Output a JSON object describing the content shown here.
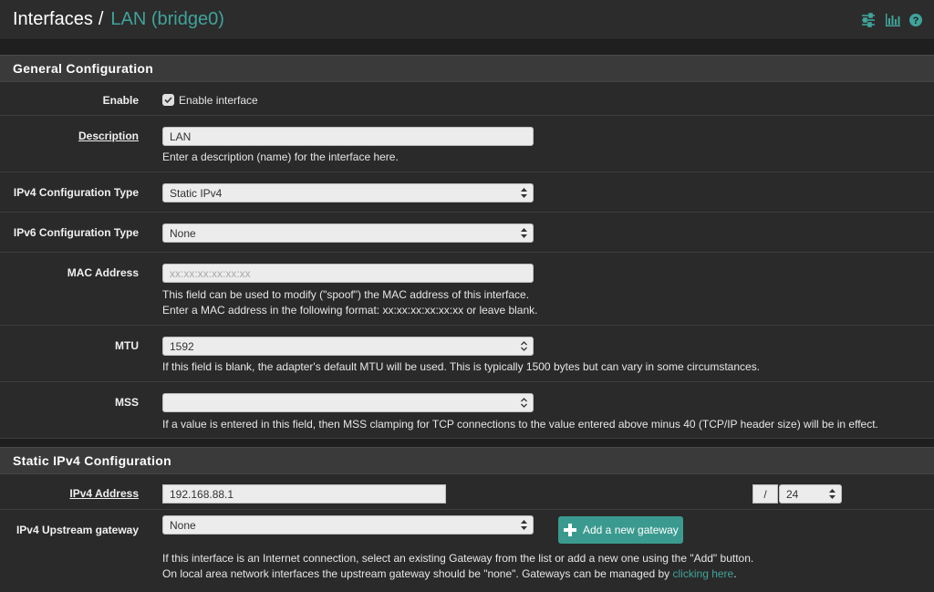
{
  "breadcrumb": {
    "section": "Interfaces",
    "separator": "/",
    "current": "LAN (bridge0)"
  },
  "top_icons": [
    "sliders-icon",
    "bar-chart-icon",
    "help-icon"
  ],
  "general": {
    "heading": "General Configuration",
    "enable_label": "Enable",
    "enable_checkbox_label": "Enable interface",
    "enable_checked": true,
    "description_label": "Description",
    "description_value": "LAN",
    "description_help": "Enter a description (name) for the interface here.",
    "ipv4_type_label": "IPv4 Configuration Type",
    "ipv4_type_value": "Static IPv4",
    "ipv6_type_label": "IPv6 Configuration Type",
    "ipv6_type_value": "None",
    "mac_label": "MAC Address",
    "mac_placeholder": "xx:xx:xx:xx:xx:xx",
    "mac_help1": "This field can be used to modify (\"spoof\") the MAC address of this interface.",
    "mac_help2": "Enter a MAC address in the following format: xx:xx:xx:xx:xx:xx or leave blank.",
    "mtu_label": "MTU",
    "mtu_value": "1592",
    "mtu_help": "If this field is blank, the adapter's default MTU will be used. This is typically 1500 bytes but can vary in some circumstances.",
    "mss_label": "MSS",
    "mss_value": "",
    "mss_help": "If a value is entered in this field, then MSS clamping for TCP connections to the value entered above minus 40 (TCP/IP header size) will be in effect."
  },
  "static_ipv4": {
    "heading": "Static IPv4 Configuration",
    "address_label": "IPv4 Address",
    "address_value": "192.168.88.1",
    "slash": "/",
    "prefix_value": "24",
    "gateway_label": "IPv4 Upstream gateway",
    "gateway_value": "None",
    "add_gateway_button": "Add a new gateway",
    "gateway_help1": "If this interface is an Internet connection, select an existing Gateway from the list or add a new one using the \"Add\" button.",
    "gateway_help2_prefix": "On local area network interfaces the upstream gateway should be \"none\". Gateways can be managed by ",
    "gateway_help2_link": "clicking here",
    "gateway_help2_suffix": "."
  },
  "colors": {
    "accent": "#3fa39a",
    "button": "#3a9a8f",
    "background": "#1f1f1f",
    "panel": "#2a2a2a"
  }
}
